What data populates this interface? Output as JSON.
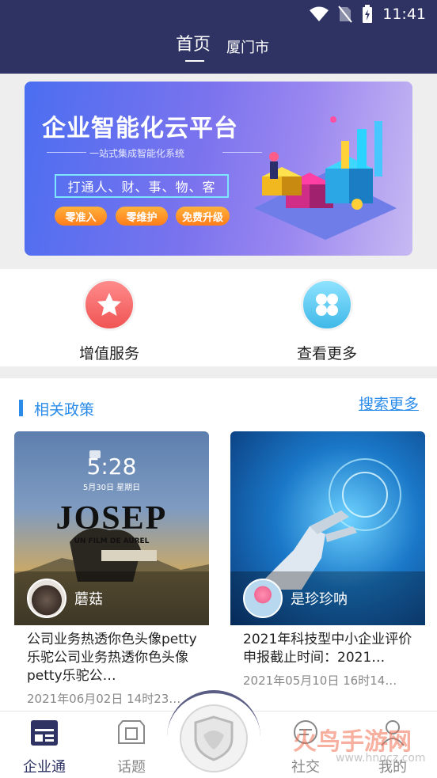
{
  "status_bar": {
    "time": "11:41"
  },
  "header": {
    "title": "首页",
    "city": "厦门市"
  },
  "banner": {
    "title": "企业智能化云平台",
    "subtitle": "一站式集成智能化系统",
    "tagline": "打通人、财、事、物、客",
    "pills": [
      "零准入",
      "零维护",
      "免费升级"
    ]
  },
  "services": [
    {
      "label": "增值服务",
      "icon": "star-icon"
    },
    {
      "label": "查看更多",
      "icon": "grid-icon"
    }
  ],
  "policy": {
    "title": "相关政策",
    "more": "搜索更多",
    "cards": [
      {
        "image_text": "JOSEP",
        "image_subtext": "UN FILM DE AUREL",
        "lock_time": "5:28",
        "lock_date": "5月30日 星期日",
        "user": "蘑菇",
        "text": "公司业务热透你色头像petty乐驼公司业务热透你色头像petty乐驼公…",
        "date": "2021年06月02日 14时23…"
      },
      {
        "user": "是珍珍呐",
        "text": "2021年科技型中小企业评价\n申报截止时间：2021…",
        "date": "2021年05月10日 16时14…"
      }
    ]
  },
  "tabbar": {
    "items": [
      {
        "label": "企业通",
        "icon": "enterprise-icon"
      },
      {
        "label": "话题",
        "icon": "topic-icon"
      },
      {
        "label": "社交",
        "icon": "social-icon"
      },
      {
        "label": "我的",
        "icon": "profile-icon"
      }
    ]
  },
  "watermark": {
    "text": "火鸟手游网",
    "url": "www.hnqcz.com"
  },
  "colors": {
    "header": "#2e3363",
    "accent": "#2a8be8",
    "pill": "#ff8f24"
  }
}
